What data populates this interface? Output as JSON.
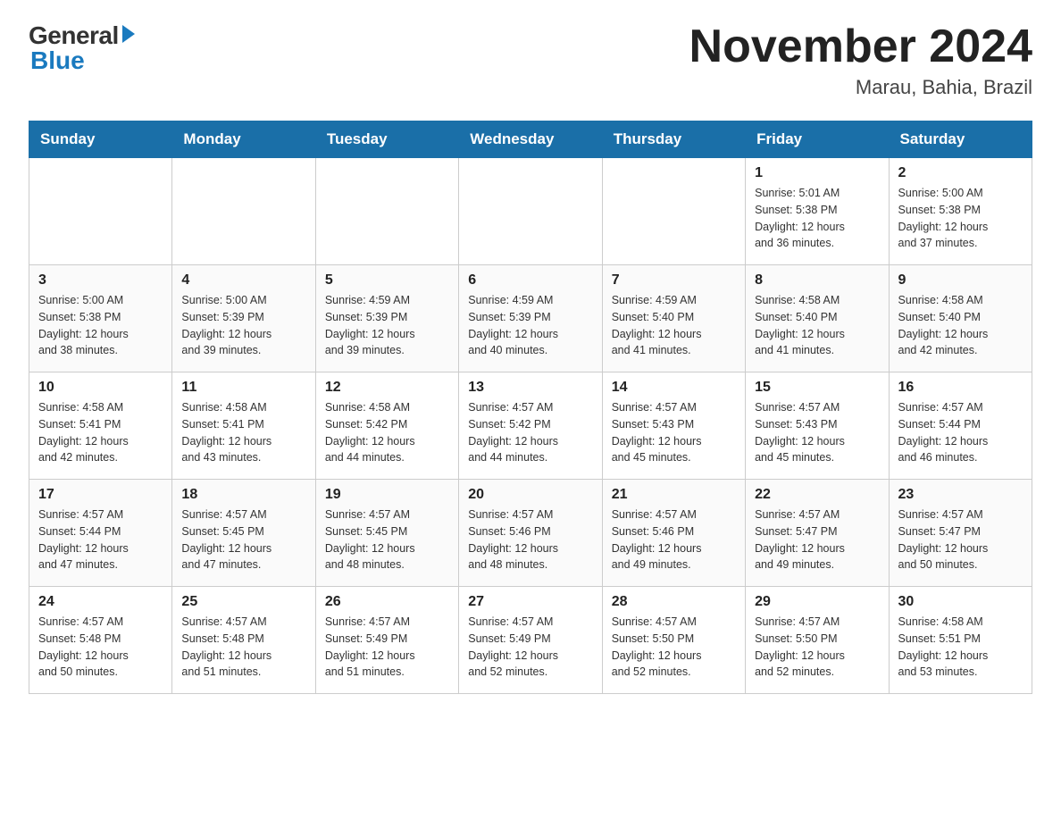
{
  "header": {
    "logo_general": "General",
    "logo_blue": "Blue",
    "month_title": "November 2024",
    "location": "Marau, Bahia, Brazil"
  },
  "weekdays": [
    "Sunday",
    "Monday",
    "Tuesday",
    "Wednesday",
    "Thursday",
    "Friday",
    "Saturday"
  ],
  "weeks": [
    [
      {
        "day": "",
        "info": ""
      },
      {
        "day": "",
        "info": ""
      },
      {
        "day": "",
        "info": ""
      },
      {
        "day": "",
        "info": ""
      },
      {
        "day": "",
        "info": ""
      },
      {
        "day": "1",
        "info": "Sunrise: 5:01 AM\nSunset: 5:38 PM\nDaylight: 12 hours\nand 36 minutes."
      },
      {
        "day": "2",
        "info": "Sunrise: 5:00 AM\nSunset: 5:38 PM\nDaylight: 12 hours\nand 37 minutes."
      }
    ],
    [
      {
        "day": "3",
        "info": "Sunrise: 5:00 AM\nSunset: 5:38 PM\nDaylight: 12 hours\nand 38 minutes."
      },
      {
        "day": "4",
        "info": "Sunrise: 5:00 AM\nSunset: 5:39 PM\nDaylight: 12 hours\nand 39 minutes."
      },
      {
        "day": "5",
        "info": "Sunrise: 4:59 AM\nSunset: 5:39 PM\nDaylight: 12 hours\nand 39 minutes."
      },
      {
        "day": "6",
        "info": "Sunrise: 4:59 AM\nSunset: 5:39 PM\nDaylight: 12 hours\nand 40 minutes."
      },
      {
        "day": "7",
        "info": "Sunrise: 4:59 AM\nSunset: 5:40 PM\nDaylight: 12 hours\nand 41 minutes."
      },
      {
        "day": "8",
        "info": "Sunrise: 4:58 AM\nSunset: 5:40 PM\nDaylight: 12 hours\nand 41 minutes."
      },
      {
        "day": "9",
        "info": "Sunrise: 4:58 AM\nSunset: 5:40 PM\nDaylight: 12 hours\nand 42 minutes."
      }
    ],
    [
      {
        "day": "10",
        "info": "Sunrise: 4:58 AM\nSunset: 5:41 PM\nDaylight: 12 hours\nand 42 minutes."
      },
      {
        "day": "11",
        "info": "Sunrise: 4:58 AM\nSunset: 5:41 PM\nDaylight: 12 hours\nand 43 minutes."
      },
      {
        "day": "12",
        "info": "Sunrise: 4:58 AM\nSunset: 5:42 PM\nDaylight: 12 hours\nand 44 minutes."
      },
      {
        "day": "13",
        "info": "Sunrise: 4:57 AM\nSunset: 5:42 PM\nDaylight: 12 hours\nand 44 minutes."
      },
      {
        "day": "14",
        "info": "Sunrise: 4:57 AM\nSunset: 5:43 PM\nDaylight: 12 hours\nand 45 minutes."
      },
      {
        "day": "15",
        "info": "Sunrise: 4:57 AM\nSunset: 5:43 PM\nDaylight: 12 hours\nand 45 minutes."
      },
      {
        "day": "16",
        "info": "Sunrise: 4:57 AM\nSunset: 5:44 PM\nDaylight: 12 hours\nand 46 minutes."
      }
    ],
    [
      {
        "day": "17",
        "info": "Sunrise: 4:57 AM\nSunset: 5:44 PM\nDaylight: 12 hours\nand 47 minutes."
      },
      {
        "day": "18",
        "info": "Sunrise: 4:57 AM\nSunset: 5:45 PM\nDaylight: 12 hours\nand 47 minutes."
      },
      {
        "day": "19",
        "info": "Sunrise: 4:57 AM\nSunset: 5:45 PM\nDaylight: 12 hours\nand 48 minutes."
      },
      {
        "day": "20",
        "info": "Sunrise: 4:57 AM\nSunset: 5:46 PM\nDaylight: 12 hours\nand 48 minutes."
      },
      {
        "day": "21",
        "info": "Sunrise: 4:57 AM\nSunset: 5:46 PM\nDaylight: 12 hours\nand 49 minutes."
      },
      {
        "day": "22",
        "info": "Sunrise: 4:57 AM\nSunset: 5:47 PM\nDaylight: 12 hours\nand 49 minutes."
      },
      {
        "day": "23",
        "info": "Sunrise: 4:57 AM\nSunset: 5:47 PM\nDaylight: 12 hours\nand 50 minutes."
      }
    ],
    [
      {
        "day": "24",
        "info": "Sunrise: 4:57 AM\nSunset: 5:48 PM\nDaylight: 12 hours\nand 50 minutes."
      },
      {
        "day": "25",
        "info": "Sunrise: 4:57 AM\nSunset: 5:48 PM\nDaylight: 12 hours\nand 51 minutes."
      },
      {
        "day": "26",
        "info": "Sunrise: 4:57 AM\nSunset: 5:49 PM\nDaylight: 12 hours\nand 51 minutes."
      },
      {
        "day": "27",
        "info": "Sunrise: 4:57 AM\nSunset: 5:49 PM\nDaylight: 12 hours\nand 52 minutes."
      },
      {
        "day": "28",
        "info": "Sunrise: 4:57 AM\nSunset: 5:50 PM\nDaylight: 12 hours\nand 52 minutes."
      },
      {
        "day": "29",
        "info": "Sunrise: 4:57 AM\nSunset: 5:50 PM\nDaylight: 12 hours\nand 52 minutes."
      },
      {
        "day": "30",
        "info": "Sunrise: 4:58 AM\nSunset: 5:51 PM\nDaylight: 12 hours\nand 53 minutes."
      }
    ]
  ]
}
